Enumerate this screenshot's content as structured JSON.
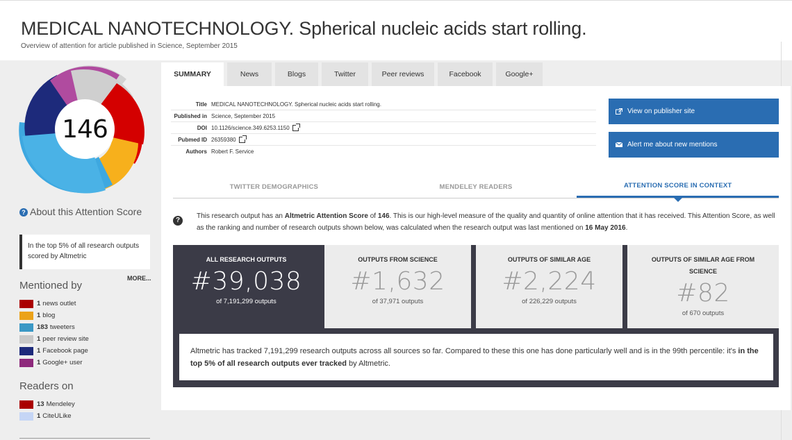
{
  "header": {
    "title": "MEDICAL NANOTECHNOLOGY. Spherical nucleic acids start rolling.",
    "subtitle": "Overview of attention for article published in Science, September 2015"
  },
  "score": {
    "value": "146",
    "donut_colors": [
      "#dd0000",
      "#f7b01c",
      "#3ea8e0",
      "#cccccc",
      "#1d2a7b",
      "#b04b9f"
    ]
  },
  "about": {
    "heading": "About this Attention Score",
    "context": "In the top 5% of all research outputs scored by Altmetric",
    "more": "MORE..."
  },
  "mentioned": {
    "heading": "Mentioned by",
    "items": [
      {
        "count": "1",
        "label": "news outlet",
        "color": "#aa0000"
      },
      {
        "count": "1",
        "label": "blog",
        "color": "#eba21a"
      },
      {
        "count": "183",
        "label": "tweeters",
        "color": "#3b98c5"
      },
      {
        "count": "1",
        "label": "peer review site",
        "color": "#c8c8c8"
      },
      {
        "count": "1",
        "label": "Facebook page",
        "color": "#1d2a7b"
      },
      {
        "count": "1",
        "label": "Google+ user",
        "color": "#8e2a7c"
      }
    ]
  },
  "readers": {
    "heading": "Readers on",
    "items": [
      {
        "count": "13",
        "label": "Mendeley",
        "color": "#aa0000"
      },
      {
        "count": "1",
        "label": "CiteULike",
        "color": "#c5d5f5"
      }
    ]
  },
  "tabs": [
    "SUMMARY",
    "News",
    "Blogs",
    "Twitter",
    "Peer reviews",
    "Facebook",
    "Google+"
  ],
  "meta": {
    "title_label": "Title",
    "title_value": "MEDICAL NANOTECHNOLOGY. Spherical nucleic acids start rolling.",
    "published_label": "Published in",
    "published_value": "Science, September 2015",
    "doi_label": "DOI",
    "doi_value": "10.1126/science.349.6253.1150",
    "pubmed_label": "Pubmed ID",
    "pubmed_value": "26359380",
    "authors_label": "Authors",
    "authors_value": "Robert F. Service"
  },
  "buttons": {
    "publisher": "View on publisher site",
    "alert": "Alert me about new mentions"
  },
  "subtabs": [
    "TWITTER DEMOGRAPHICS",
    "MENDELEY READERS",
    "ATTENTION SCORE IN CONTEXT"
  ],
  "description": {
    "p1": "This research output has an ",
    "b1": "Altmetric Attention Score",
    "p2": " of ",
    "b2": "146",
    "p3": ". This is our high-level measure of the quality and quantity of online attention that it has received. This Attention Score, as well as the ranking and number of research outputs shown below, was calculated when the research output was last mentioned on ",
    "b3": "16 May 2016",
    "p4": "."
  },
  "stats": [
    {
      "label": "ALL RESEARCH OUTPUTS",
      "rank": "#39,038",
      "of": "of 7,191,299 outputs"
    },
    {
      "label": "OUTPUTS FROM SCIENCE",
      "rank": "#1,632",
      "of": "of 37,971 outputs"
    },
    {
      "label": "OUTPUTS OF SIMILAR AGE",
      "rank": "#2,224",
      "of": "of 226,229 outputs"
    },
    {
      "label": "OUTPUTS OF SIMILAR AGE FROM SCIENCE",
      "rank": "#82",
      "of": "of 670 outputs"
    }
  ],
  "summary": {
    "p1": "Altmetric has tracked 7,191,299 research outputs across all sources so far. Compared to these this one has done particularly well and is in the 99th percentile: it's ",
    "b1": "in the top 5% of all research outputs ever tracked",
    "p2": " by Altmetric."
  }
}
